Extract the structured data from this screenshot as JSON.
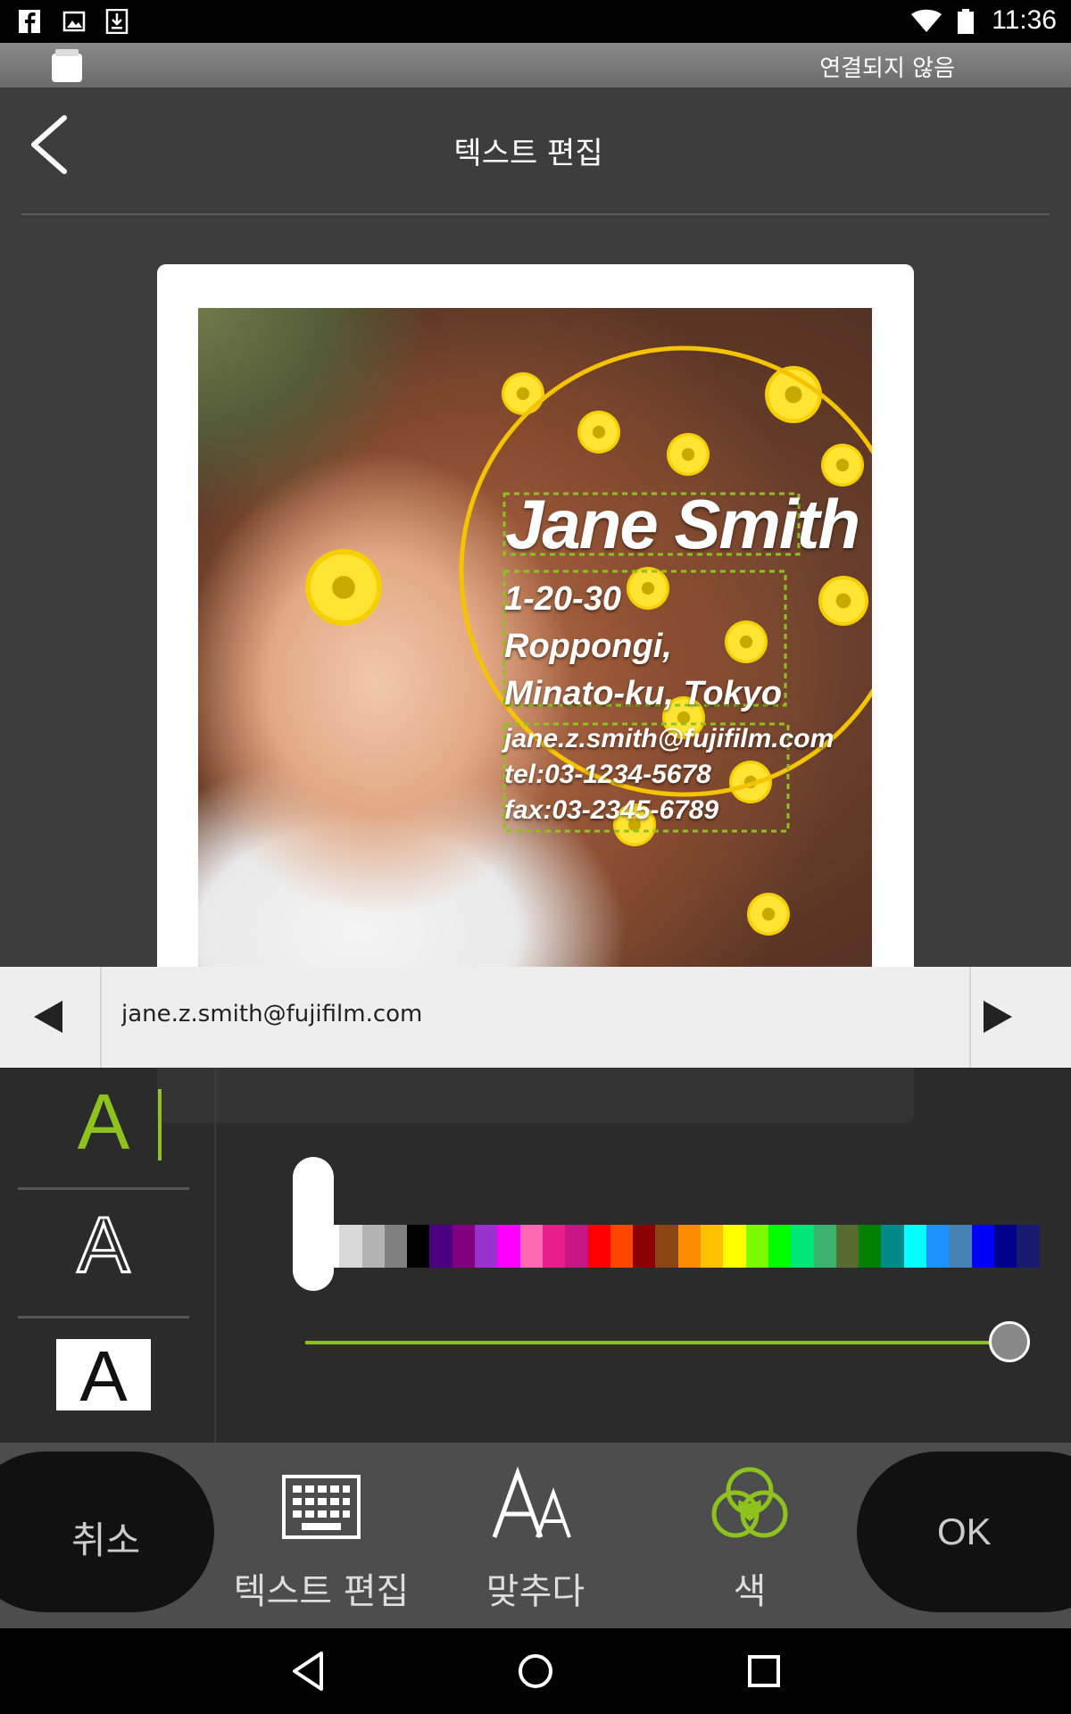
{
  "status_bar": {
    "time": "11:36",
    "left_icons": [
      "facebook-icon",
      "image-icon",
      "download-icon"
    ],
    "right_icons": [
      "wifi-icon",
      "battery-icon"
    ]
  },
  "connection": {
    "status": "연결되지 않음",
    "device_icon": "printer-device-icon"
  },
  "header": {
    "title": "텍스트 편집",
    "back_icon": "back-chevron-icon"
  },
  "card": {
    "name": "Jane Smith",
    "address_lines": [
      "1-20-30",
      "Roppongi,",
      "Minato-ku, Tokyo"
    ],
    "contact_lines": [
      "jane.z.smith@fujifilm.com",
      "tel:03-1234-5678",
      "fax:03-2345-6789"
    ],
    "frame_color": "#f5c300",
    "selection_color": "#8dc21f"
  },
  "field": {
    "value": "jane.z.smith@fujifilm.com",
    "prev_icon": "left-arrow-icon",
    "next_icon": "right-arrow-icon"
  },
  "styles": {
    "items": [
      {
        "glyph": "A",
        "kind": "fill",
        "selected": true
      },
      {
        "glyph": "A",
        "kind": "outline",
        "selected": false
      },
      {
        "glyph": "A",
        "kind": "box",
        "selected": false
      }
    ],
    "accent": "#8dc21f",
    "opacity_level": 1.0
  },
  "palette": [
    "#ffffff",
    "#d9d9d9",
    "#b3b3b3",
    "#808080",
    "#000000",
    "#4b0082",
    "#800080",
    "#9932cc",
    "#ff00ff",
    "#ff69b4",
    "#e91e8c",
    "#c71585",
    "#ff0000",
    "#ff4500",
    "#8b0000",
    "#8b4513",
    "#ff8c00",
    "#ffc000",
    "#ffff00",
    "#7cfc00",
    "#00ff00",
    "#00e676",
    "#3cb371",
    "#556b2f",
    "#008000",
    "#008b8b",
    "#00ffff",
    "#1e90ff",
    "#4682b4",
    "#0000ff",
    "#00008b",
    "#191970"
  ],
  "toolbar": {
    "cancel": "취소",
    "ok": "OK",
    "items": [
      {
        "label": "텍스트 편집",
        "icon": "keyboard-icon"
      },
      {
        "label": "맞추다",
        "icon": "font-size-icon"
      },
      {
        "label": "색",
        "icon": "color-circles-icon",
        "active": true
      }
    ]
  },
  "nav": {
    "icons": [
      "nav-back-icon",
      "nav-home-icon",
      "nav-recents-icon"
    ]
  }
}
